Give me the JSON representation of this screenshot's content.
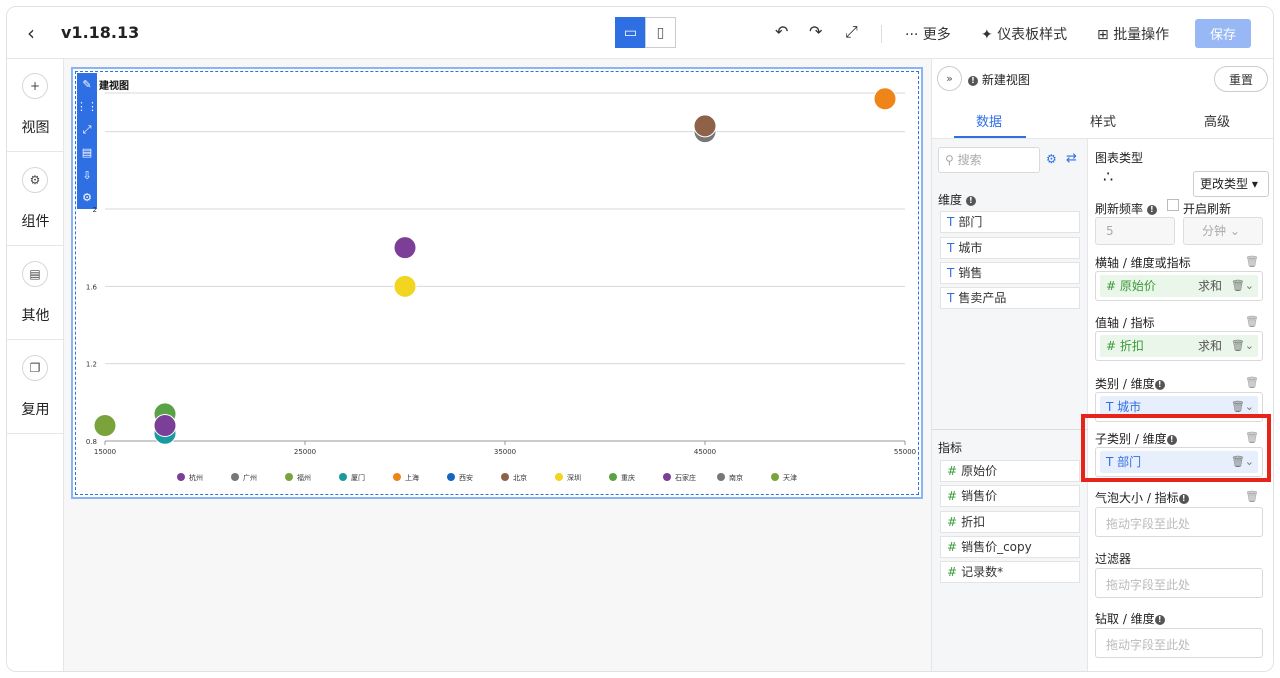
{
  "topbar": {
    "version": "v1.18.13",
    "more": "··· 更多",
    "dashboard_style": "仪表板样式",
    "batch_ops": "批量操作",
    "save": "保存"
  },
  "leftnav": {
    "items": [
      {
        "label": "视图",
        "icon": "plus-circle-icon"
      },
      {
        "label": "组件",
        "icon": "gear-icon"
      },
      {
        "label": "其他",
        "icon": "widget-icon"
      },
      {
        "label": "复用",
        "icon": "copy-icon"
      }
    ]
  },
  "chart_title": "建视图",
  "chart_data": {
    "type": "scatter",
    "xlim": [
      15000,
      55000
    ],
    "ylim": [
      0.8,
      2.6
    ],
    "x_ticks": [
      "15000",
      "25000",
      "35000",
      "45000",
      "55000"
    ],
    "y_ticks": [
      "0.8",
      "1.2",
      "1.6",
      "2"
    ],
    "grid": true,
    "legend_position": "bottom",
    "legend": [
      {
        "name": "杭州",
        "color": "#7b3f98"
      },
      {
        "name": "广州",
        "color": "#777777"
      },
      {
        "name": "福州",
        "color": "#7aa33b"
      },
      {
        "name": "厦门",
        "color": "#1a9aa0"
      },
      {
        "name": "上海",
        "color": "#ef8519"
      },
      {
        "name": "西安",
        "color": "#1565c0"
      },
      {
        "name": "北京",
        "color": "#8e6148"
      },
      {
        "name": "深圳",
        "color": "#f1d51f"
      },
      {
        "name": "重庆",
        "color": "#5aa246"
      },
      {
        "name": "石家庄",
        "color": "#7b3f98"
      },
      {
        "name": "南京",
        "color": "#777777"
      },
      {
        "name": "天津",
        "color": "#7aa33b"
      }
    ],
    "points": [
      {
        "x": 15000,
        "y": 0.88,
        "color": "#7aa33b"
      },
      {
        "x": 18000,
        "y": 0.84,
        "color": "#1a9aa0"
      },
      {
        "x": 18000,
        "y": 0.94,
        "color": "#5aa246"
      },
      {
        "x": 18000,
        "y": 0.88,
        "color": "#7b3f98"
      },
      {
        "x": 30000,
        "y": 1.6,
        "color": "#f1d51f"
      },
      {
        "x": 30000,
        "y": 1.8,
        "color": "#7b3f98"
      },
      {
        "x": 45000,
        "y": 2.4,
        "color": "#777777"
      },
      {
        "x": 45000,
        "y": 2.43,
        "color": "#8e6148"
      },
      {
        "x": 54000,
        "y": 2.57,
        "color": "#ef8519"
      }
    ]
  },
  "panel": {
    "view_name": "新建视图",
    "reset": "重置",
    "tabs": [
      "数据",
      "样式",
      "高级"
    ],
    "search_placeholder": "搜索",
    "dimension_label": "维度",
    "dimensions": [
      "部门",
      "城市",
      "销售",
      "售卖产品"
    ],
    "metric_label": "指标",
    "metrics": [
      "原始价",
      "销售价",
      "折扣",
      "销售价_copy",
      "记录数*"
    ],
    "chart_type_label": "图表类型",
    "change_type": "更改类型",
    "refresh_label": "刷新频率",
    "refresh_enable": "开启刷新",
    "refresh_value": "5",
    "refresh_unit": "分钟",
    "x_axis_label": "横轴 / 维度或指标",
    "x_axis_field": "原始价",
    "x_axis_agg": "求和",
    "y_axis_label": "值轴 / 指标",
    "y_axis_field": "折扣",
    "y_axis_agg": "求和",
    "category_label": "类别 / 维度",
    "category_field": "城市",
    "subcategory_label": "子类别 / 维度",
    "subcategory_field": "部门",
    "bubble_label": "气泡大小 / 指标",
    "drag_placeholder": "拖动字段至此处",
    "filter_label": "过滤器",
    "drill_label": "钻取 / 维度"
  }
}
